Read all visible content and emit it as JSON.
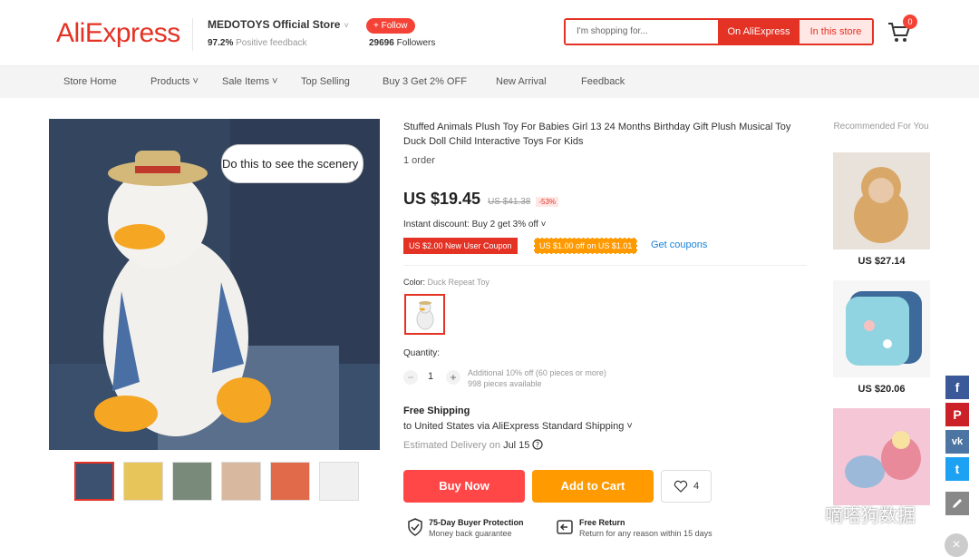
{
  "header": {
    "logo": "AliExpress",
    "store_name": "MEDOTOYS Official Store",
    "store_caret": "˅",
    "feedback_percent": "97.2%",
    "feedback_label": "Positive feedback",
    "follow_label": "+ Follow",
    "followers_count": "29696",
    "followers_label": "Followers",
    "search_placeholder": "I'm shopping for...",
    "search_on_aliexpress": "On AliExpress",
    "search_in_store": "In this store",
    "cart_count": "0"
  },
  "nav": [
    {
      "label": "Store Home"
    },
    {
      "label": "Products ˅"
    },
    {
      "label": "Sale Items ˅"
    },
    {
      "label": "Top Selling"
    },
    {
      "label": "Buy 3 Get 2% OFF"
    },
    {
      "label": "New Arrival"
    },
    {
      "label": "Feedback"
    }
  ],
  "gallery": {
    "bubble_text": "Do this to see the scenery"
  },
  "product": {
    "title": "Stuffed Animals Plush Toy For Babies Girl 13 24 Months Birthday Gift Plush Musical Toy Duck Doll Child Interactive Toys For Kids",
    "orders": "1 order",
    "price": "US $19.45",
    "orig_price": "US $41.38",
    "discount": "-53%",
    "instant_discount": "Instant discount: Buy 2 get 3% off ˅",
    "coupon1": "US $2.00 New User Coupon",
    "coupon2": "US $1.00 off on US $1.01",
    "get_coupons": "Get coupons",
    "color_label": "Color:",
    "color_value": "Duck Repeat Toy",
    "quantity_label": "Quantity:",
    "qty_minus": "−",
    "qty_plus": "+",
    "qty_value": "1",
    "qty_note1": "Additional 10% off (60 pieces or more)",
    "qty_note2": "998 pieces available",
    "shipping_title": "Free Shipping",
    "shipping_dest": "to United States via AliExpress Standard Shipping ˅",
    "est_label": "Estimated Delivery on",
    "est_date": "Jul 15",
    "buy_now": "Buy Now",
    "add_to_cart": "Add to Cart",
    "wish_count": "4",
    "guarantee1_title": "75-Day Buyer Protection",
    "guarantee1_sub": "Money back guarantee",
    "guarantee2_title": "Free Return",
    "guarantee2_sub": "Return for any reason within 15 days"
  },
  "recommended": {
    "title": "Recommended For You",
    "items": [
      {
        "price": "US $27.14"
      },
      {
        "price": "US $20.06"
      },
      {
        "price": ""
      }
    ]
  },
  "social": {
    "facebook": "f",
    "pinterest": "P",
    "vk": "vk",
    "twitter": "t"
  },
  "watermark": "嘀嗒狗数据",
  "colors": {
    "brand": "#e43225",
    "buy": "#ff4747",
    "cart": "#ff9a00",
    "link": "#1a82d8"
  }
}
